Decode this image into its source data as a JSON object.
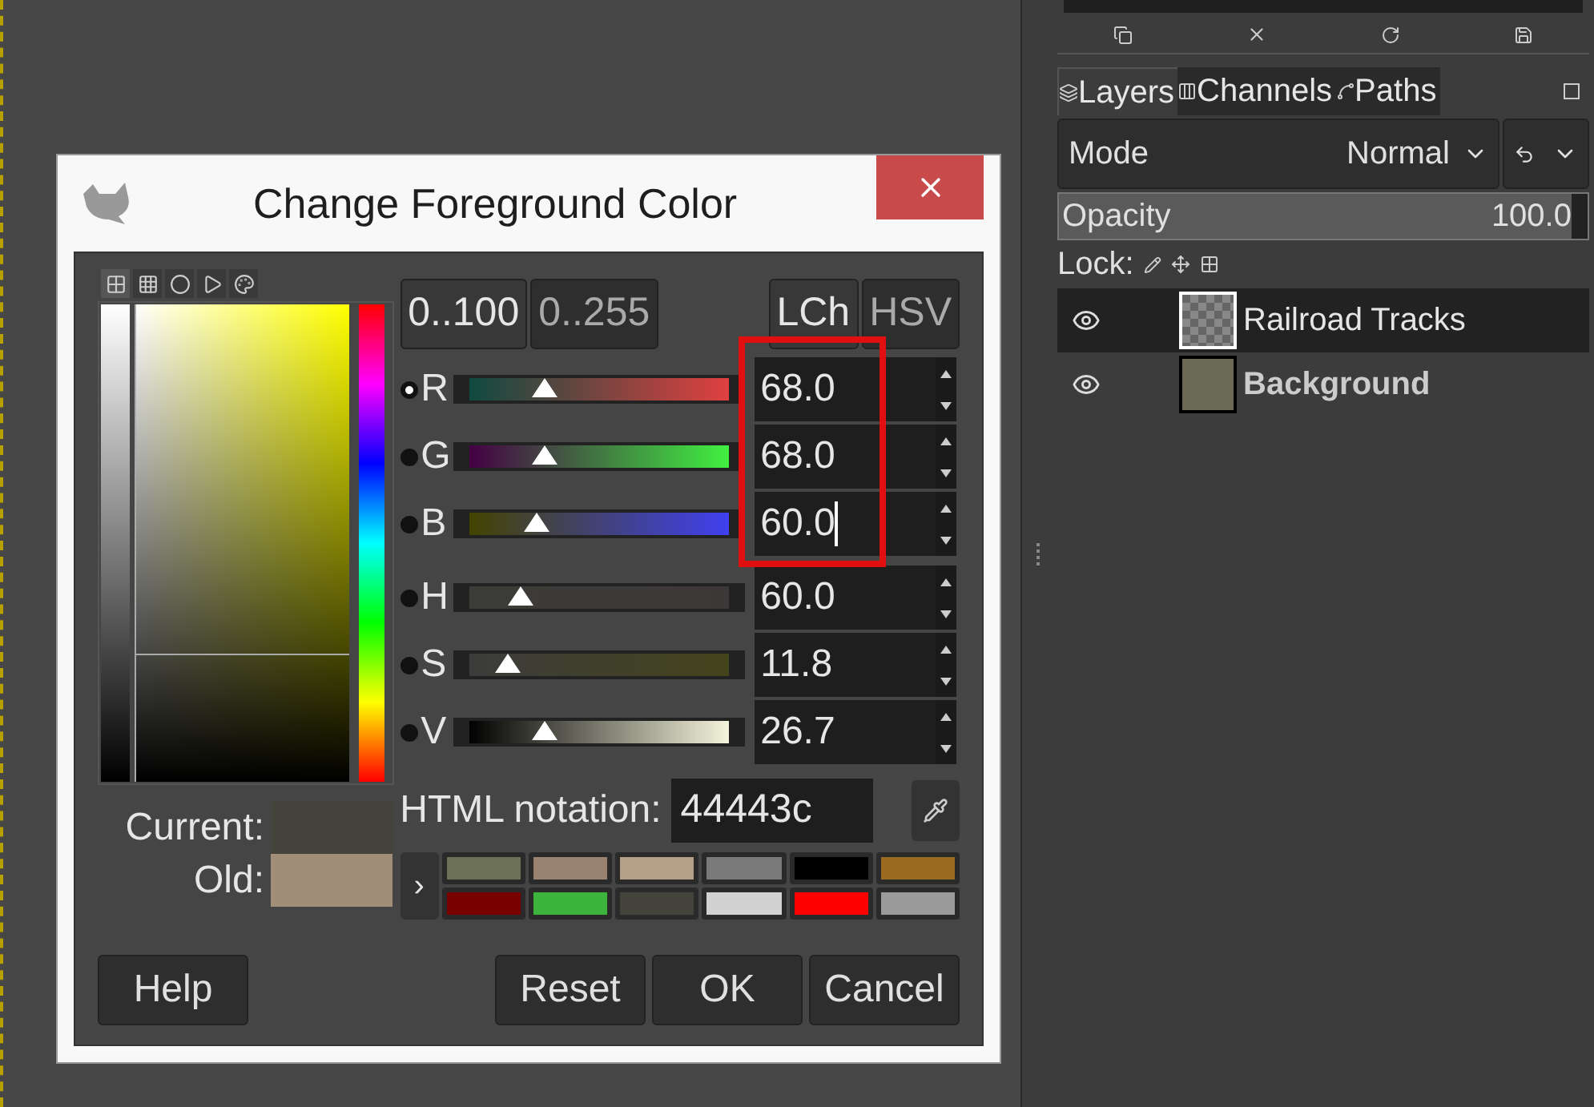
{
  "window": {
    "title": "Change Foreground Color"
  },
  "selector_tabs": [
    {
      "selected": true
    },
    {
      "selected": false
    },
    {
      "selected": false
    },
    {
      "selected": false
    },
    {
      "selected": false
    }
  ],
  "range_buttons": [
    {
      "label": "0..100",
      "selected": true
    },
    {
      "label": "0..255",
      "selected": false
    }
  ],
  "model_buttons": [
    {
      "label": "LCh",
      "selected": true
    },
    {
      "label": "HSV",
      "selected": false
    }
  ],
  "channels": [
    {
      "label": "R",
      "selected": true,
      "level": 0.29,
      "value": "68.0",
      "highlighted": true,
      "focused": false
    },
    {
      "label": "G",
      "selected": false,
      "level": 0.29,
      "value": "68.0",
      "highlighted": true,
      "focused": false
    },
    {
      "label": "B",
      "selected": false,
      "level": 0.26,
      "value": "60.0",
      "highlighted": true,
      "focused": true
    },
    {
      "label": "H",
      "selected": false,
      "level": 0.2,
      "value": "60.0",
      "highlighted": false,
      "focused": false
    },
    {
      "label": "S",
      "selected": false,
      "level": 0.15,
      "value": "11.8",
      "highlighted": false,
      "focused": false
    },
    {
      "label": "V",
      "selected": false,
      "level": 0.29,
      "value": "26.7",
      "highlighted": false,
      "focused": false
    }
  ],
  "current": {
    "label": "Current:",
    "color": "#44443c"
  },
  "old": {
    "label": "Old:",
    "color": "#a08e78"
  },
  "html_notation": {
    "label": "HTML notation:",
    "value": "44443c"
  },
  "history_button": {
    "label": "›"
  },
  "swatches": [
    {
      "color": "#6b7056"
    },
    {
      "color": "#9a8270"
    },
    {
      "color": "#b4a088"
    },
    {
      "color": "#7a7a7a"
    },
    {
      "color": "#000000"
    },
    {
      "color": "#9a6a1e"
    },
    {
      "color": "#7a0000"
    },
    {
      "color": "#3cb43c"
    },
    {
      "color": "#44443c"
    },
    {
      "color": "#d2d2d2"
    },
    {
      "color": "#ff0000"
    },
    {
      "color": "#9a9a9a"
    }
  ],
  "buttons": [
    {
      "label": "Help"
    },
    {
      "label": "Reset"
    },
    {
      "label": "OK"
    },
    {
      "label": "Cancel"
    }
  ],
  "dock": {
    "tabs": [
      {
        "label": "Layers",
        "selected": true
      },
      {
        "label": "Channels",
        "selected": false
      },
      {
        "label": "Paths",
        "selected": false
      }
    ],
    "mode": {
      "label": "Mode",
      "value": "Normal"
    },
    "opacity": {
      "label": "Opacity",
      "value": "100.0",
      "level": 1.0
    },
    "lock": {
      "label": "Lock:"
    },
    "layers": [
      {
        "name": "Railroad Tracks",
        "selected": true,
        "visible": true,
        "bold": false,
        "kind": "transparent"
      },
      {
        "name": "Background",
        "selected": false,
        "visible": true,
        "bold": true,
        "kind": "solid",
        "color": "#6b6b55"
      }
    ]
  }
}
